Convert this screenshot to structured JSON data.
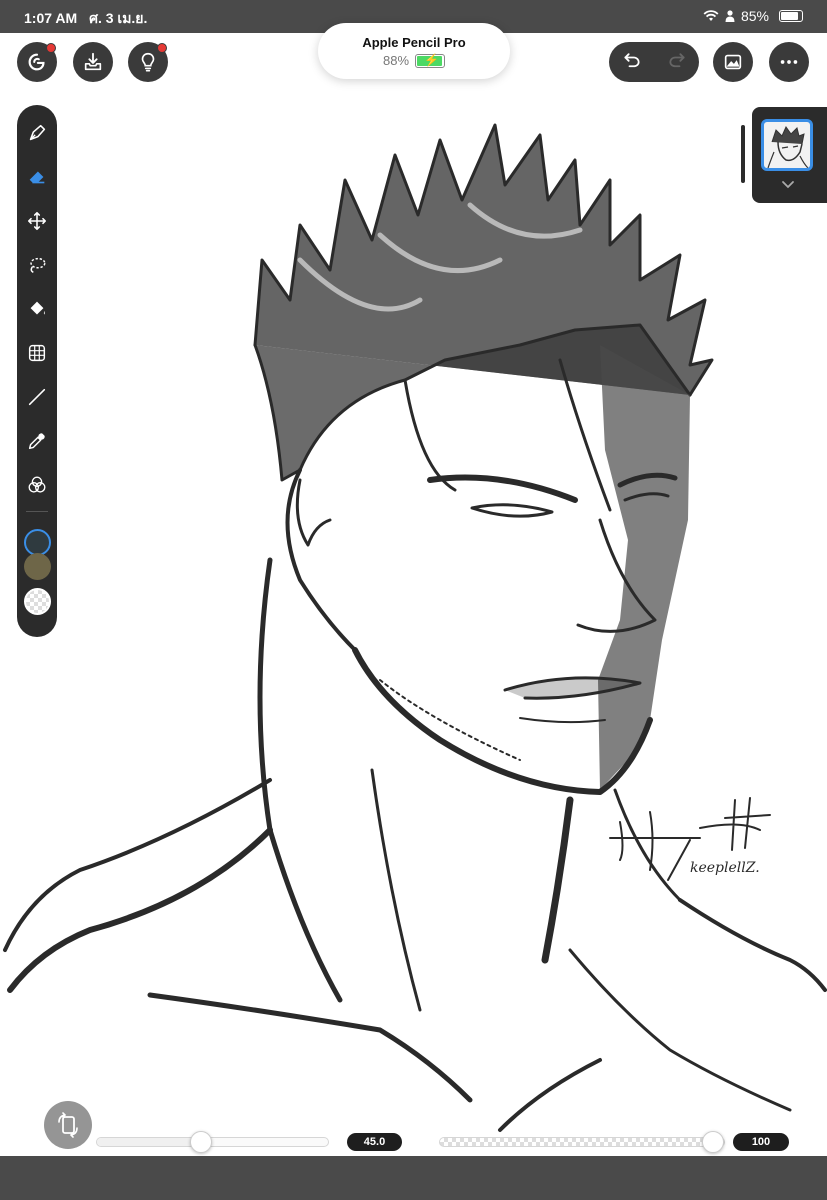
{
  "status_bar": {
    "time": "1:07 AM",
    "date": "ศ. 3 เม.ย.",
    "battery_text": "85%",
    "battery_level": 0.85
  },
  "pencil": {
    "name": "Apple Pencil Pro",
    "battery_text": "88%",
    "battery_level": 0.88,
    "charging": true
  },
  "top_left_buttons": [
    {
      "icon": "app-logo-icon",
      "badge": true
    },
    {
      "icon": "import-tray-icon",
      "badge": false
    },
    {
      "icon": "lightbulb-icon",
      "badge": true
    }
  ],
  "top_right_buttons": {
    "undo_icon": "undo-icon",
    "redo_icon": "redo-icon",
    "redo_enabled": false,
    "gallery_icon": "image-gallery-icon",
    "more_icon": "more-icon"
  },
  "toolbar": {
    "tools": [
      {
        "name": "pen-tool",
        "icon": "pen-nib-icon",
        "active": false
      },
      {
        "name": "eraser-tool",
        "icon": "eraser-icon",
        "active": true
      },
      {
        "name": "transform-tool",
        "icon": "move-arrows-icon",
        "active": false
      },
      {
        "name": "lasso-tool",
        "icon": "lasso-icon",
        "active": false
      },
      {
        "name": "fill-tool",
        "icon": "paint-bucket-icon",
        "active": false
      },
      {
        "name": "perspective-grid-tool",
        "icon": "grid-icon",
        "active": false
      },
      {
        "name": "line-tool",
        "icon": "line-icon",
        "active": false
      },
      {
        "name": "eyedropper-tool",
        "icon": "eyedropper-icon",
        "active": false
      },
      {
        "name": "color-mixer-tool",
        "icon": "color-circles-icon",
        "active": false
      }
    ],
    "swatches": [
      {
        "name": "primary-color-swatch",
        "color": "#2f3a3f",
        "selected": true
      },
      {
        "name": "secondary-color-swatch",
        "color": "#6e6648",
        "selected": false
      },
      {
        "name": "transparent-color-swatch",
        "color": "transparent",
        "selected": false
      }
    ],
    "accent_color": "#3a8ee6"
  },
  "layers": {
    "thumbnail_icon": "layer-thumbnail",
    "expand_icon": "chevron-down-icon"
  },
  "bottom_controls": {
    "flip_icon": "flip-canvas-icon",
    "brush_size_value": "45.0",
    "brush_size_fraction": 0.45,
    "opacity_value": "100",
    "opacity_fraction": 1.0
  },
  "artwork": {
    "signature_text": "keeplellZ.",
    "ink_color": "#2a2a2a"
  }
}
